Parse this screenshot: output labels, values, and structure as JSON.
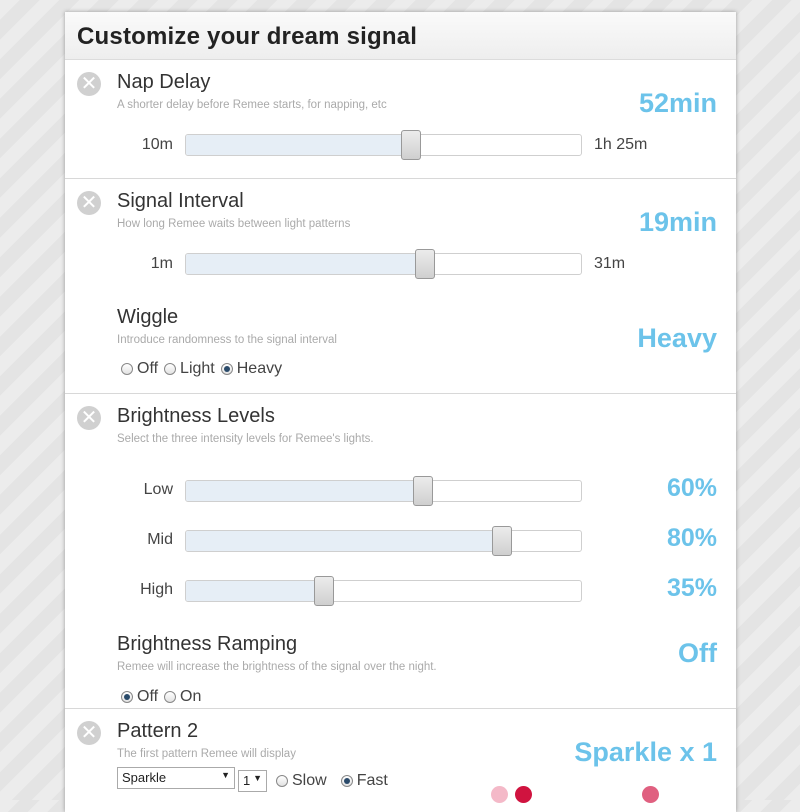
{
  "panel": {
    "title": "Customize your dream signal"
  },
  "nap_delay": {
    "title": "Nap Delay",
    "description": "A shorter delay before Remee starts, for napping, etc",
    "value": "52min",
    "min_label": "10m",
    "max_label": "1h 25m",
    "level": 0.57
  },
  "signal_interval": {
    "title": "Signal Interval",
    "description": "How long Remee waits between light patterns",
    "value": "19min",
    "min_label": "1m",
    "max_label": "31m",
    "level": 0.605
  },
  "wiggle": {
    "title": "Wiggle",
    "description": "Introduce randomness to the signal interval",
    "value": "Heavy",
    "options": [
      "Off",
      "Light",
      "Heavy"
    ],
    "selected": "Heavy"
  },
  "brightness_levels": {
    "title": "Brightness Levels",
    "description": "Select the three intensity levels for Remee's lights.",
    "rows": [
      {
        "label": "Low",
        "value": "60%",
        "level": 0.6
      },
      {
        "label": "Mid",
        "value": "80%",
        "level": 0.8
      },
      {
        "label": "High",
        "value": "35%",
        "level": 0.35
      }
    ]
  },
  "brightness_ramping": {
    "title": "Brightness Ramping",
    "description": "Remee will increase the brightness of the signal over the night.",
    "value": "Off",
    "options": [
      "Off",
      "On"
    ],
    "selected": "Off"
  },
  "pattern": {
    "title": "Pattern 2",
    "description": "The first pattern Remee will display",
    "value": "Sparkle x 1",
    "pattern_select": "Sparkle",
    "count_select": "1",
    "speed_options": [
      "Slow",
      "Fast"
    ],
    "speed_selected": "Fast",
    "colors": [
      "#f4b9c8",
      "#d0133f",
      "#e06080"
    ]
  },
  "icons": {
    "remove": "close-circle-icon",
    "dropdown": "chevron-down-icon"
  },
  "accent_color": "#6cc3ea"
}
